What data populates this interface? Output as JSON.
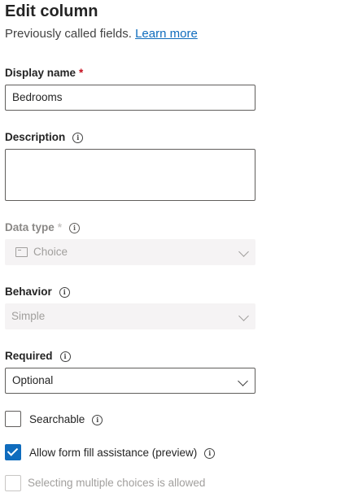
{
  "panel": {
    "title": "Edit column",
    "subtitle": "Previously called fields.",
    "learn_more": "Learn more"
  },
  "fields": {
    "display_name": {
      "label": "Display name",
      "required_mark": "*",
      "value": "Bedrooms"
    },
    "description": {
      "label": "Description",
      "value": ""
    },
    "data_type": {
      "label": "Data type",
      "required_mark": "*",
      "value": "Choice"
    },
    "behavior": {
      "label": "Behavior",
      "value": "Simple"
    },
    "required": {
      "label": "Required",
      "value": "Optional"
    }
  },
  "checkboxes": {
    "searchable": {
      "label": "Searchable",
      "checked": false
    },
    "form_fill": {
      "label": "Allow form fill assistance (preview)",
      "checked": true
    },
    "multiple_choices": {
      "label": "Selecting multiple choices is allowed",
      "checked": false,
      "disabled": true
    }
  },
  "icons": {
    "info": "i"
  },
  "colors": {
    "accent": "#0f6cbd",
    "required": "#c50f1f",
    "disabled_bg": "#f5f3f4"
  }
}
